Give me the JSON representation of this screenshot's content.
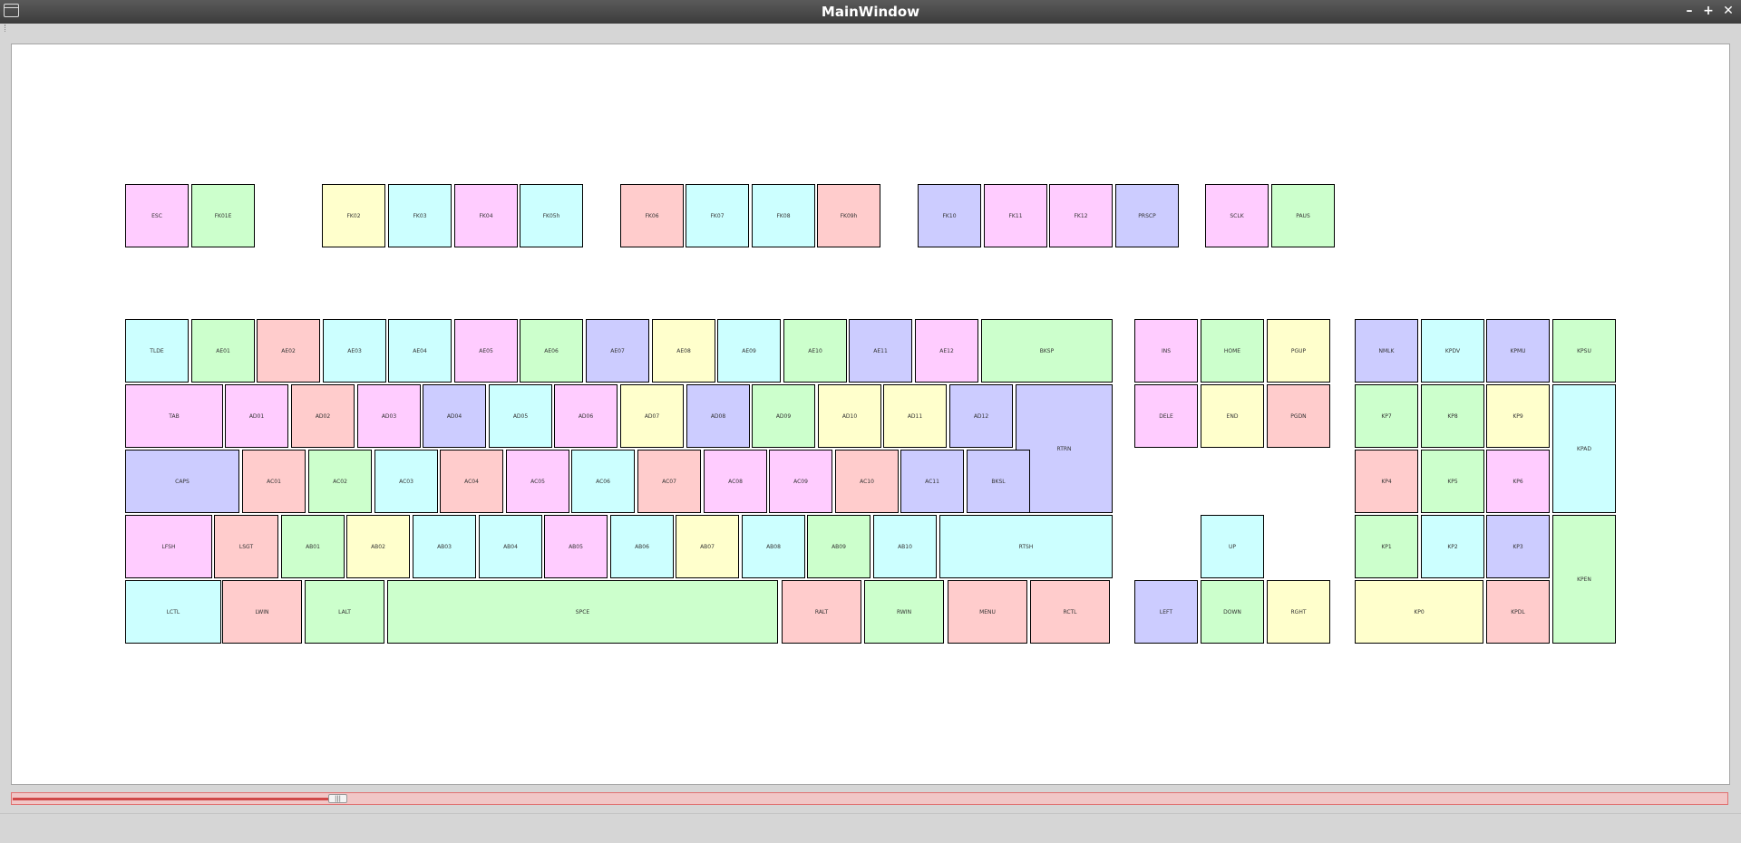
{
  "window": {
    "title": "MainWindow",
    "minimize": "–",
    "maximize": "+",
    "close": "✕"
  },
  "slider": {
    "value_fraction": 0.19,
    "handle_glyph": "|||"
  },
  "colors": {
    "pink": "#ffccff",
    "green": "#ccffcc",
    "yellow": "#ffffcc",
    "cyan": "#ccffff",
    "red": "#ffcccc",
    "blue": "#ccccff"
  },
  "keys": [
    {
      "label": "ESC",
      "color": "pink"
    },
    {
      "label": "FK01E",
      "color": "green"
    },
    {
      "label": "FK02",
      "color": "yellow"
    },
    {
      "label": "FK03",
      "color": "cyan"
    },
    {
      "label": "FK04",
      "color": "pink"
    },
    {
      "label": "FK05h",
      "color": "cyan"
    },
    {
      "label": "FK06",
      "color": "red"
    },
    {
      "label": "FK07",
      "color": "cyan"
    },
    {
      "label": "FK08",
      "color": "cyan"
    },
    {
      "label": "FK09h",
      "color": "red"
    },
    {
      "label": "FK10",
      "color": "blue"
    },
    {
      "label": "FK11",
      "color": "pink"
    },
    {
      "label": "FK12",
      "color": "pink"
    },
    {
      "label": "PRSCP",
      "color": "blue"
    },
    {
      "label": "SCLK",
      "color": "pink"
    },
    {
      "label": "PAUS",
      "color": "green"
    },
    {
      "label": "TLDE",
      "color": "cyan"
    },
    {
      "label": "AE01",
      "color": "green"
    },
    {
      "label": "AE02",
      "color": "red"
    },
    {
      "label": "AE03",
      "color": "cyan"
    },
    {
      "label": "AE04",
      "color": "cyan"
    },
    {
      "label": "AE05",
      "color": "pink"
    },
    {
      "label": "AE06",
      "color": "green"
    },
    {
      "label": "AE07",
      "color": "blue"
    },
    {
      "label": "AE08",
      "color": "yellow"
    },
    {
      "label": "AE09",
      "color": "cyan"
    },
    {
      "label": "AE10",
      "color": "green"
    },
    {
      "label": "AE11",
      "color": "blue"
    },
    {
      "label": "AE12",
      "color": "pink"
    },
    {
      "label": "BKSP",
      "color": "green"
    },
    {
      "label": "INS",
      "color": "pink"
    },
    {
      "label": "HOME",
      "color": "green"
    },
    {
      "label": "PGUP",
      "color": "yellow"
    },
    {
      "label": "NMLK",
      "color": "blue"
    },
    {
      "label": "KPDV",
      "color": "cyan"
    },
    {
      "label": "KPMU",
      "color": "blue"
    },
    {
      "label": "KPSU",
      "color": "green"
    },
    {
      "label": "TAB",
      "color": "pink"
    },
    {
      "label": "AD01",
      "color": "pink"
    },
    {
      "label": "AD02",
      "color": "red"
    },
    {
      "label": "AD03",
      "color": "pink"
    },
    {
      "label": "AD04",
      "color": "blue"
    },
    {
      "label": "AD05",
      "color": "cyan"
    },
    {
      "label": "AD06",
      "color": "pink"
    },
    {
      "label": "AD07",
      "color": "yellow"
    },
    {
      "label": "AD08",
      "color": "blue"
    },
    {
      "label": "AD09",
      "color": "green"
    },
    {
      "label": "AD10",
      "color": "yellow"
    },
    {
      "label": "AD11",
      "color": "yellow"
    },
    {
      "label": "AD12",
      "color": "blue"
    },
    {
      "label": "RTRN",
      "color": "blue"
    },
    {
      "label": "DELE",
      "color": "pink"
    },
    {
      "label": "END",
      "color": "yellow"
    },
    {
      "label": "PGDN",
      "color": "red"
    },
    {
      "label": "KP7",
      "color": "green"
    },
    {
      "label": "KP8",
      "color": "green"
    },
    {
      "label": "KP9",
      "color": "yellow"
    },
    {
      "label": "KPAD",
      "color": "cyan"
    },
    {
      "label": "CAPS",
      "color": "blue"
    },
    {
      "label": "AC01",
      "color": "red"
    },
    {
      "label": "AC02",
      "color": "green"
    },
    {
      "label": "AC03",
      "color": "cyan"
    },
    {
      "label": "AC04",
      "color": "red"
    },
    {
      "label": "AC05",
      "color": "pink"
    },
    {
      "label": "AC06",
      "color": "cyan"
    },
    {
      "label": "AC07",
      "color": "red"
    },
    {
      "label": "AC08",
      "color": "pink"
    },
    {
      "label": "AC09",
      "color": "pink"
    },
    {
      "label": "AC10",
      "color": "red"
    },
    {
      "label": "AC11",
      "color": "blue"
    },
    {
      "label": "BKSL",
      "color": "blue"
    },
    {
      "label": "KP4",
      "color": "red"
    },
    {
      "label": "KP5",
      "color": "green"
    },
    {
      "label": "KP6",
      "color": "pink"
    },
    {
      "label": "LFSH",
      "color": "pink"
    },
    {
      "label": "LSGT",
      "color": "red"
    },
    {
      "label": "AB01",
      "color": "green"
    },
    {
      "label": "AB02",
      "color": "yellow"
    },
    {
      "label": "AB03",
      "color": "cyan"
    },
    {
      "label": "AB04",
      "color": "cyan"
    },
    {
      "label": "AB05",
      "color": "pink"
    },
    {
      "label": "AB06",
      "color": "cyan"
    },
    {
      "label": "AB07",
      "color": "yellow"
    },
    {
      "label": "AB08",
      "color": "cyan"
    },
    {
      "label": "AB09",
      "color": "green"
    },
    {
      "label": "AB10",
      "color": "cyan"
    },
    {
      "label": "RTSH",
      "color": "cyan"
    },
    {
      "label": "UP",
      "color": "cyan"
    },
    {
      "label": "KP1",
      "color": "green"
    },
    {
      "label": "KP2",
      "color": "cyan"
    },
    {
      "label": "KP3",
      "color": "blue"
    },
    {
      "label": "KPEN",
      "color": "green"
    },
    {
      "label": "LCTL",
      "color": "cyan"
    },
    {
      "label": "LWIN",
      "color": "red"
    },
    {
      "label": "LALT",
      "color": "green"
    },
    {
      "label": "SPCE",
      "color": "green"
    },
    {
      "label": "RALT",
      "color": "red"
    },
    {
      "label": "RWIN",
      "color": "green"
    },
    {
      "label": "MENU",
      "color": "red"
    },
    {
      "label": "RCTL",
      "color": "red"
    },
    {
      "label": "LEFT",
      "color": "blue"
    },
    {
      "label": "DOWN",
      "color": "green"
    },
    {
      "label": "RGHT",
      "color": "yellow"
    },
    {
      "label": "KP0",
      "color": "yellow"
    },
    {
      "label": "KPDL",
      "color": "red"
    }
  ]
}
